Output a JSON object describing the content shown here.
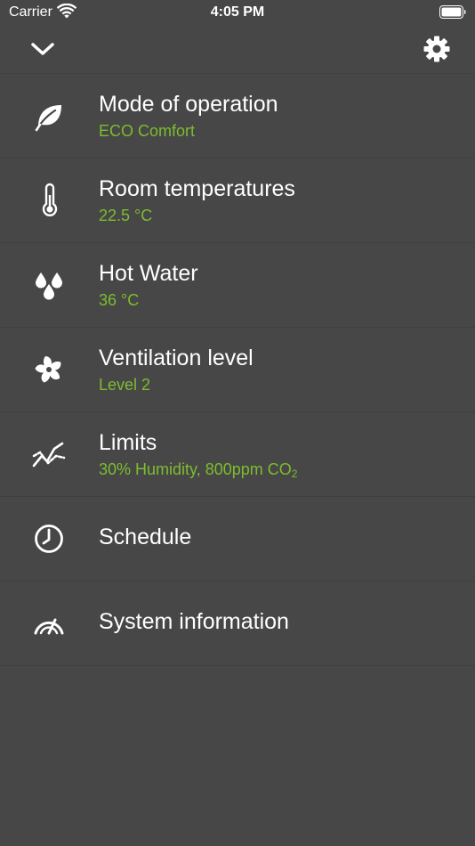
{
  "status_bar": {
    "carrier": "Carrier",
    "time": "4:05 PM"
  },
  "colors": {
    "background": "#474747",
    "accent_green": "#7dbd2e",
    "text": "#ffffff"
  },
  "toolbar": {
    "collapse_icon": "chevron-down-icon",
    "settings_icon": "gear-icon"
  },
  "menu": {
    "items": [
      {
        "icon": "leaf-icon",
        "title": "Mode of operation",
        "subtitle": "ECO Comfort"
      },
      {
        "icon": "thermometer-icon",
        "title": "Room temperatures",
        "subtitle": "22.5 °C"
      },
      {
        "icon": "water-drops-icon",
        "title": "Hot Water",
        "subtitle": "36 °C"
      },
      {
        "icon": "fan-icon",
        "title": "Ventilation level",
        "subtitle": "Level 2"
      },
      {
        "icon": "trend-chart-icon",
        "title": "Limits",
        "subtitle_main": "30% Humidity, 800ppm CO",
        "subtitle_sub": "2"
      },
      {
        "icon": "clock-icon",
        "title": "Schedule"
      },
      {
        "icon": "gauge-icon",
        "title": "System information"
      }
    ]
  }
}
